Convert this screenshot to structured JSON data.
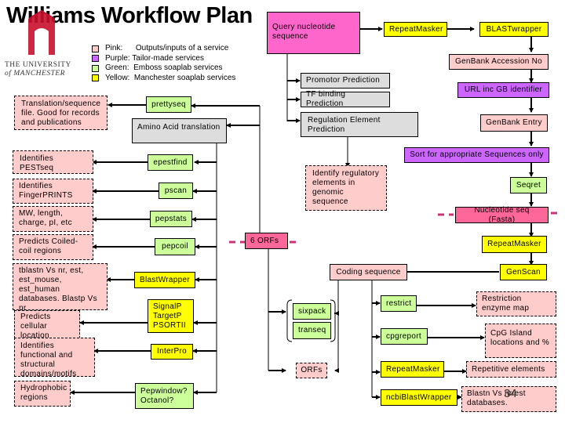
{
  "title": "Williams Workflow Plan",
  "university": {
    "line1": "THE UNIVERSITY",
    "line2": "of MANCHESTER"
  },
  "legend": [
    {
      "label": "Pink:      Outputs/inputs of a service",
      "color": "#ffcccc"
    },
    {
      "label": "Purple: Tailor-made services",
      "color": "#cc66ff"
    },
    {
      "label": "Green:  Emboss soaplab services",
      "color": "#ccff99"
    },
    {
      "label": "Yellow:  Manchester soaplab services",
      "color": "#ffff00"
    }
  ],
  "colors": {
    "pink": "#ffcccc",
    "purple": "#cc66ff",
    "green": "#ccff99",
    "yellow": "#ffff00",
    "grey": "#dddddd",
    "magenta": "#ff66cc",
    "hot_pink": "#ff6699",
    "dash_line": "#cc3377"
  },
  "nodes": {
    "query": "Query nucleotide sequence",
    "repeatmasker_top": "RepeatMasker",
    "blastwrapper_top": "BLASTwrapper",
    "genbank_accession": "GenBank Accession No",
    "url_gb": "URL inc GB identifier",
    "genbank_entry": "GenBank Entry",
    "sort_sequences": "Sort for appropriate Sequences only",
    "seqret": "Seqret",
    "nucleotide_fasta": "Nucleotide seq (Fasta)",
    "repeatmasker_mid": "RepeatMasker",
    "genscan": "GenScan",
    "coding_sequence": "Coding sequence",
    "promotor": "Promotor Prediction",
    "tf_binding": "TF binding Prediction",
    "regulation": "Regulation Element Prediction",
    "identify_regulatory": "Identify regulatory elements in genomic sequence",
    "six_orfs": "6 ORFs",
    "prettyseq": "prettyseq",
    "amino_acid": "Amino Acid translation",
    "epestfind": "epestfind",
    "pscan": "pscan",
    "pepstats": "pepstats",
    "pepcoil": "pepcoil",
    "blastwrapper_left": "BlastWrapper",
    "signalp": "SignalP TargetP PSORTII",
    "interpro": "InterPro",
    "pepwindow": "Pepwindow? Octanol?",
    "out_translation": "Translation/sequence file. Good for records and publications",
    "out_pest": "Identifies PESTseq",
    "out_fingerprints": "Identifies FingerPRINTS",
    "out_mw": "MW, length, charge, pI, etc",
    "out_coiled": "Predicts Coiled-coil regions",
    "out_tblastn": "tblastn Vs nr, est, est_mouse, est_human databases. Blastp Vs nr",
    "out_cellular": "Predicts cellular location",
    "out_functional": "Identifies functional and structural domains/motifs",
    "out_hydrophobic": "Hydrophobic regions",
    "sixpack": "sixpack",
    "transeq": "transeq",
    "orfs": "ORFs",
    "restrict": "restrict",
    "cpgreport": "cpgreport",
    "repeatmasker_bottom": "RepeatMasker",
    "ncbiblastwrapper": "ncbiBlastWrapper",
    "out_restriction": "Restriction enzyme map",
    "out_cpg": "CpG Island locations and %",
    "out_repetitive": "Repetitive elements",
    "out_blastn": "Blastn Vs nr/est databases."
  },
  "slide_number": "34"
}
